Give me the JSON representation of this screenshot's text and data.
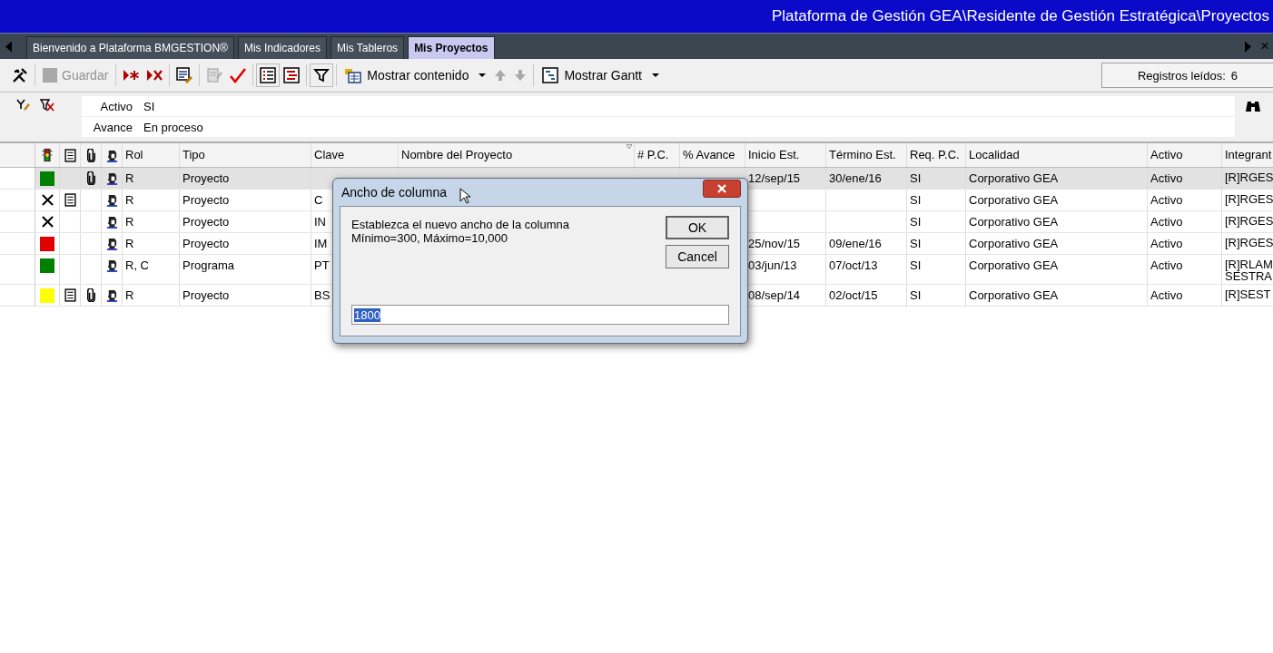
{
  "window": {
    "title": "Plataforma de Gestión GEA\\Residente de Gestión Estratégica\\Proyectos"
  },
  "tabs": [
    {
      "label": "Bienvenido a Plataforma BMGESTION®",
      "selected": false
    },
    {
      "label": "Mis Indicadores",
      "selected": false
    },
    {
      "label": "Mis Tableros",
      "selected": false
    },
    {
      "label": "Mis Proyectos",
      "selected": true
    }
  ],
  "tab_close": "×",
  "toolbar": {
    "save": {
      "label": "Guardar",
      "disabled": true
    },
    "content": {
      "label": "Mostrar contenido"
    },
    "gantt": {
      "label": "Mostrar Gantt"
    }
  },
  "records": {
    "label": "Registros leídos:",
    "value": "6"
  },
  "filters": [
    {
      "label": "Activo",
      "value": "SI"
    },
    {
      "label": "Avance",
      "value": "En proceso"
    }
  ],
  "table": {
    "columns": [
      {
        "label": "Rol",
        "sorted": false
      },
      {
        "label": "Tipo",
        "sorted": false
      },
      {
        "label": "Clave",
        "sorted": false
      },
      {
        "label": "Nombre del Proyecto",
        "sorted": true
      },
      {
        "label": "# P.C.",
        "sorted": false
      },
      {
        "label": "% Avance",
        "sorted": false
      },
      {
        "label": "Inicio Est.",
        "sorted": false
      },
      {
        "label": "Término Est.",
        "sorted": false
      },
      {
        "label": "Req. P.C.",
        "sorted": false
      },
      {
        "label": "Localidad",
        "sorted": false
      },
      {
        "label": "Activo",
        "sorted": false
      },
      {
        "label": "Integrant",
        "sorted": false
      }
    ],
    "rows": [
      {
        "selected": true,
        "status": {
          "kind": "square",
          "color": "#008000"
        },
        "note": false,
        "attachment": true,
        "cells": [
          "R",
          "Proyecto",
          null,
          null,
          null,
          null,
          "12/sep/15",
          "30/ene/16",
          "SI",
          "Corporativo GEA",
          "Activo"
        ],
        "integrantes": [
          "[R]RGES"
        ]
      },
      {
        "selected": false,
        "status": {
          "kind": "x"
        },
        "note": true,
        "attachment": false,
        "cells": [
          "R",
          "Proyecto",
          "C",
          null,
          null,
          null,
          null,
          null,
          "SI",
          "Corporativo GEA",
          "Activo"
        ],
        "integrantes": [
          "[R]RGES"
        ]
      },
      {
        "selected": false,
        "status": {
          "kind": "x"
        },
        "note": false,
        "attachment": false,
        "cells": [
          "R",
          "Proyecto",
          "IN",
          null,
          null,
          null,
          null,
          null,
          "SI",
          "Corporativo GEA",
          "Activo"
        ],
        "integrantes": [
          "[R]RGES"
        ]
      },
      {
        "selected": false,
        "status": {
          "kind": "square",
          "color": "#e00000"
        },
        "note": false,
        "attachment": false,
        "cells": [
          "R",
          "Proyecto",
          "IM",
          null,
          null,
          null,
          "25/nov/15",
          "09/ene/16",
          "SI",
          "Corporativo GEA",
          "Activo"
        ],
        "integrantes": [
          "[R]RGES"
        ]
      },
      {
        "selected": false,
        "status": {
          "kind": "square",
          "color": "#008000"
        },
        "note": false,
        "attachment": false,
        "cells": [
          "R, C",
          "Programa",
          "PT",
          null,
          null,
          null,
          "03/jun/13",
          "07/oct/13",
          "SI",
          "Corporativo GEA",
          "Activo"
        ],
        "integrantes": [
          "[R]RLAM",
          "SESTRA"
        ]
      },
      {
        "selected": false,
        "status": {
          "kind": "square",
          "color": "#ffff00"
        },
        "note": true,
        "attachment": true,
        "cells": [
          "R",
          "Proyecto",
          "BS",
          null,
          null,
          null,
          "08/sep/14",
          "02/oct/15",
          "SI",
          "Corporativo GEA",
          "Activo"
        ],
        "integrantes": [
          "[R]SEST"
        ]
      }
    ]
  },
  "dialog": {
    "title": "Ancho de columna",
    "message": [
      "Establezca el nuevo ancho de la columna",
      "Mínimo=300, Máximo=10,000"
    ],
    "buttons": [
      "OK",
      "Cancel"
    ],
    "input": {
      "value": "1800"
    }
  }
}
